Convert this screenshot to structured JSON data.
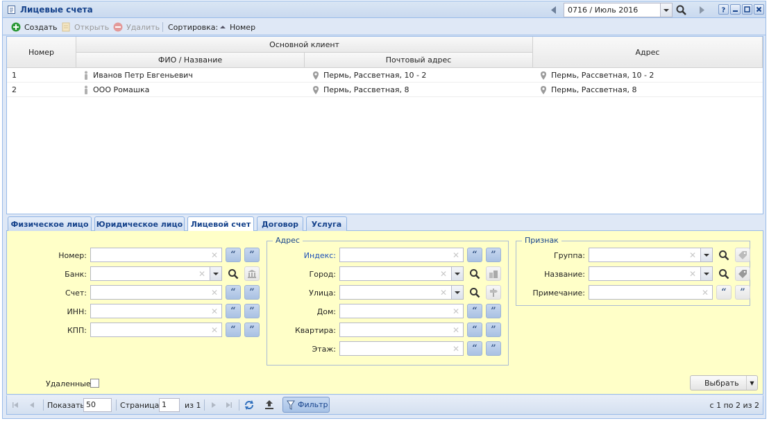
{
  "window": {
    "title": "Лицевые счета",
    "period": "0716 / Июль 2016"
  },
  "toolbar": {
    "create": "Создать",
    "open": "Открыть",
    "delete": "Удалить",
    "sort_label": "Сортировка:",
    "sort_field": "Номер"
  },
  "grid": {
    "headers": {
      "number": "Номер",
      "main_client": "Основной клиент",
      "name": "ФИО / Название",
      "postal": "Почтовый адрес",
      "address": "Адрес"
    },
    "rows": [
      {
        "number": "1",
        "name": "Иванов Петр Евгеньевич",
        "postal": "Пермь, Рассветная, 10 - 2",
        "address": "Пермь, Рассветная, 10 - 2"
      },
      {
        "number": "2",
        "name": "ООО Ромашка",
        "postal": "Пермь, Рассветная, 8",
        "address": "Пермь, Рассветная, 8"
      }
    ]
  },
  "tabs": [
    "Физическое лицо",
    "Юридическое лицо",
    "Лицевой счет",
    "Договор",
    "Услуга"
  ],
  "form": {
    "left": {
      "number": "Номер:",
      "bank": "Банк:",
      "account": "Счет:",
      "inn": "ИНН:",
      "kpp": "КПП:"
    },
    "address": {
      "legend": "Адрес",
      "index": "Индекс:",
      "city": "Город:",
      "street": "Улица:",
      "house": "Дом:",
      "flat": "Квартира:",
      "floor": "Этаж:"
    },
    "attr": {
      "legend": "Признак",
      "group": "Группа:",
      "name": "Название:",
      "note": "Примечание:"
    },
    "deleted": "Удаленные:",
    "select": "Выбрать"
  },
  "pager": {
    "show": "Показать",
    "page_size": "50",
    "page": "Страница",
    "page_num": "1",
    "of": "из 1",
    "filter": "Фильтр",
    "summary": "с 1 по 2 из 2"
  }
}
